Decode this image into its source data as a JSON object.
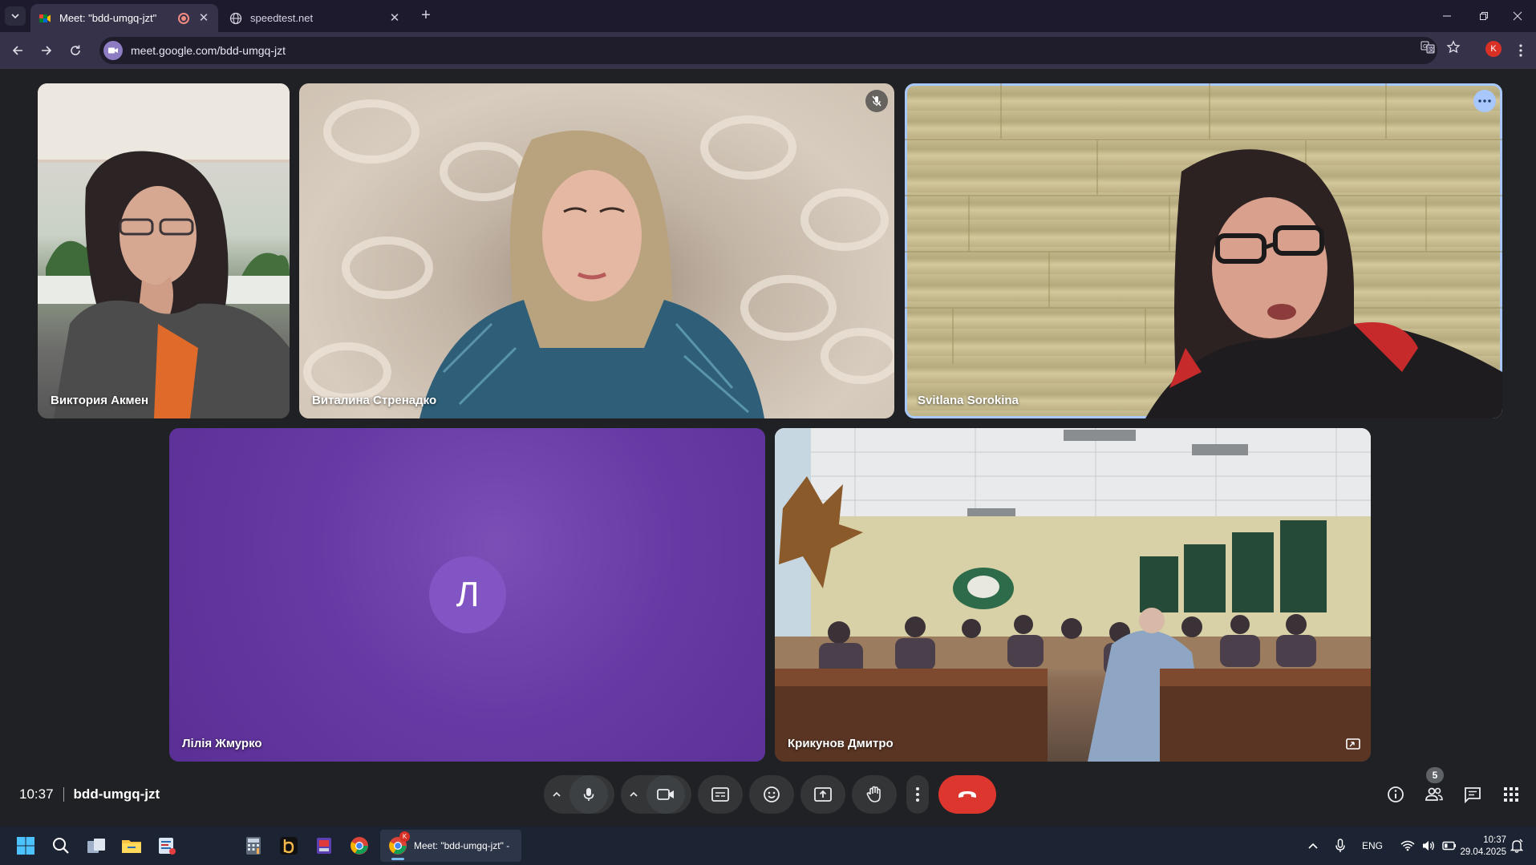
{
  "browser": {
    "tabs": [
      {
        "title": "Meet: \"bdd-umgq-jzt\"",
        "active": true
      },
      {
        "title": "speedtest.net",
        "active": false
      }
    ],
    "url": "meet.google.com/bdd-umgq-jzt",
    "profile_initial": "K"
  },
  "meet": {
    "participants": [
      {
        "name": "Виктория Акмен"
      },
      {
        "name": "Виталина Стренадко",
        "muted": true
      },
      {
        "name": "Svitlana Sorokina",
        "speaking": true
      },
      {
        "name": "Лілія Жмурко",
        "avatar_letter": "Л",
        "camera_off": true
      },
      {
        "name": "Крикунов Дмитро"
      }
    ],
    "time": "10:37",
    "meeting_code": "bdd-umgq-jzt",
    "people_count": "5"
  },
  "taskbar": {
    "active_window_title": "Meet: \"bdd-umgq-jzt\" -",
    "chrome_badge": "K",
    "language": "ENG",
    "clock_time": "10:37",
    "clock_date": "29.04.2025"
  },
  "colors": {
    "hangup": "#dc362e",
    "speaking_outline": "#a8c7fa",
    "avatar_bg": "#8255c4"
  }
}
